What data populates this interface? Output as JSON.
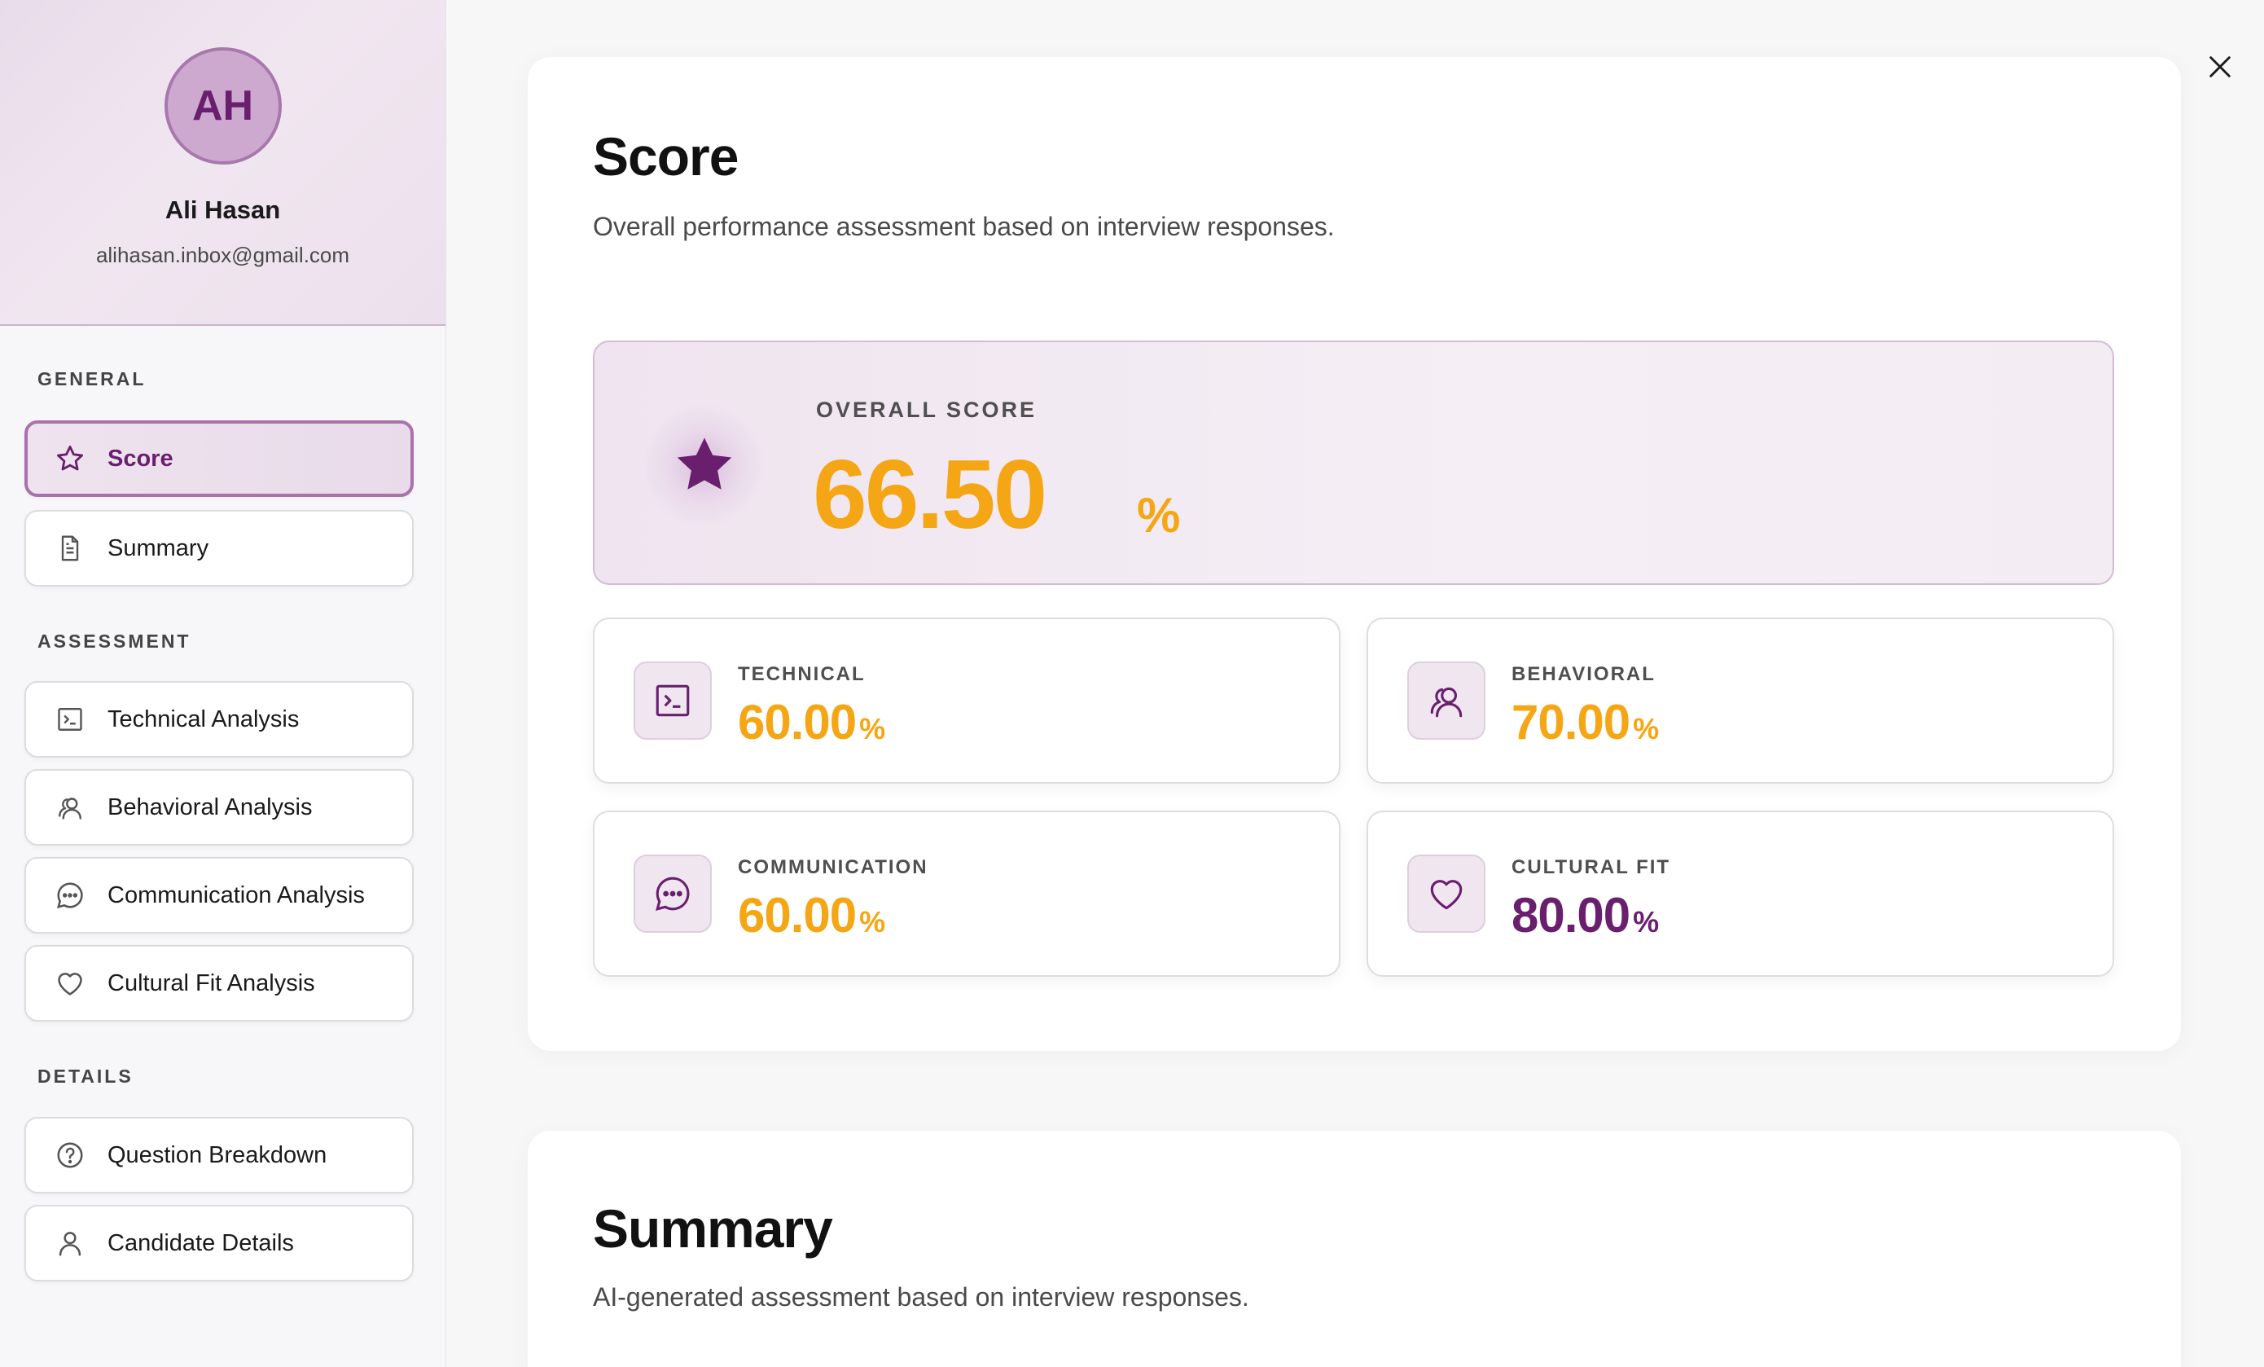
{
  "profile": {
    "initials": "AH",
    "name": "Ali Hasan",
    "email": "alihasan.inbox@gmail.com"
  },
  "nav": {
    "general_title": "GENERAL",
    "assessment_title": "ASSESSMENT",
    "details_title": "DETAILS",
    "items": [
      {
        "label": "Score",
        "icon": "star-icon",
        "active": true
      },
      {
        "label": "Summary",
        "icon": "document-icon",
        "active": false
      },
      {
        "label": "Technical Analysis",
        "icon": "terminal-icon",
        "active": false
      },
      {
        "label": "Behavioral Analysis",
        "icon": "users-icon",
        "active": false
      },
      {
        "label": "Communication Analysis",
        "icon": "chat-bubble-icon",
        "active": false
      },
      {
        "label": "Cultural Fit Analysis",
        "icon": "heart-icon",
        "active": false
      },
      {
        "label": "Question Breakdown",
        "icon": "question-circle-icon",
        "active": false
      },
      {
        "label": "Candidate Details",
        "icon": "user-icon",
        "active": false
      }
    ]
  },
  "score": {
    "title": "Score",
    "subtitle": "Overall performance assessment based on interview responses.",
    "overall": {
      "label": "OVERALL SCORE",
      "value": "66.50",
      "unit": "%",
      "icon": "star-icon"
    },
    "metrics": [
      {
        "label": "TECHNICAL",
        "value": "60.00",
        "unit": "%",
        "icon": "terminal-icon",
        "color": "#f5a614"
      },
      {
        "label": "BEHAVIORAL",
        "value": "70.00",
        "unit": "%",
        "icon": "users-icon",
        "color": "#f5a614"
      },
      {
        "label": "COMMUNICATION",
        "value": "60.00",
        "unit": "%",
        "icon": "chat-bubble-icon",
        "color": "#f5a614"
      },
      {
        "label": "CULTURAL FIT",
        "value": "80.00",
        "unit": "%",
        "icon": "heart-icon",
        "color": "#6a1f6e"
      }
    ]
  },
  "summary": {
    "title": "Summary",
    "subtitle": "AI-generated assessment based on interview responses."
  },
  "colors": {
    "accent_purple": "#6a1f6e",
    "score_orange": "#f5a614"
  }
}
